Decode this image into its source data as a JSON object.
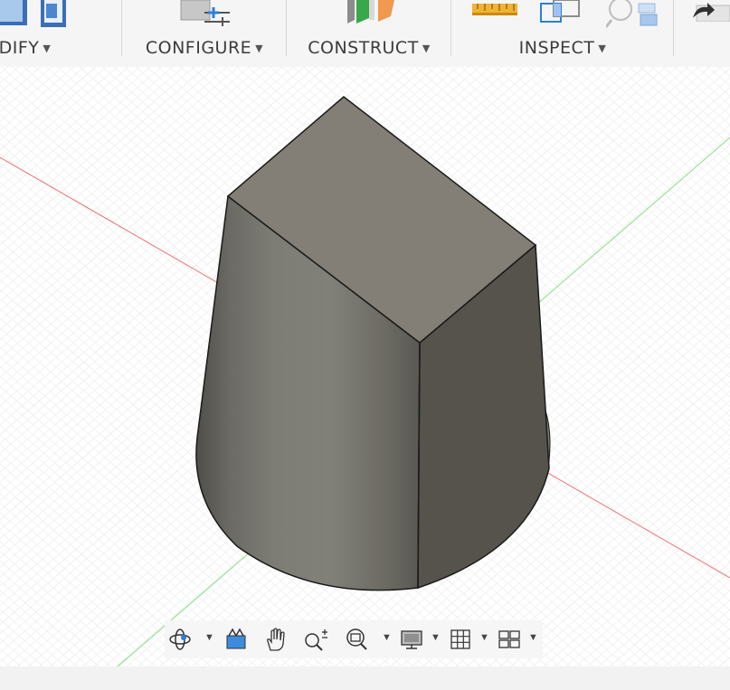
{
  "toolbar": {
    "groups": [
      {
        "label": "DIFY",
        "caret": "▼"
      },
      {
        "label": "CONFIGURE",
        "caret": "▼"
      },
      {
        "label": "CONSTRUCT",
        "caret": "▼"
      },
      {
        "label": "INSPECT",
        "caret": "▼"
      }
    ]
  },
  "navbar": {
    "caret": "▼",
    "items": [
      {
        "icon": "orbit-icon",
        "has_dropdown": true
      },
      {
        "icon": "look-at-icon",
        "has_dropdown": false
      },
      {
        "icon": "pan-hand-icon",
        "has_dropdown": false
      },
      {
        "icon": "zoom-icon",
        "has_dropdown": false
      },
      {
        "icon": "zoom-window-icon",
        "has_dropdown": true
      },
      {
        "icon": "display-settings-icon",
        "has_dropdown": true
      },
      {
        "icon": "grid-settings-icon",
        "has_dropdown": true
      },
      {
        "icon": "viewports-icon",
        "has_dropdown": true
      }
    ]
  },
  "colors": {
    "grid_line": "#e3e3e3",
    "x_axis": "#f07070",
    "y_axis": "#7ee07e",
    "body_top": "#837f76",
    "body_side": "#6f6d66",
    "body_right": "#55534c",
    "edge": "#1a1a1a"
  }
}
